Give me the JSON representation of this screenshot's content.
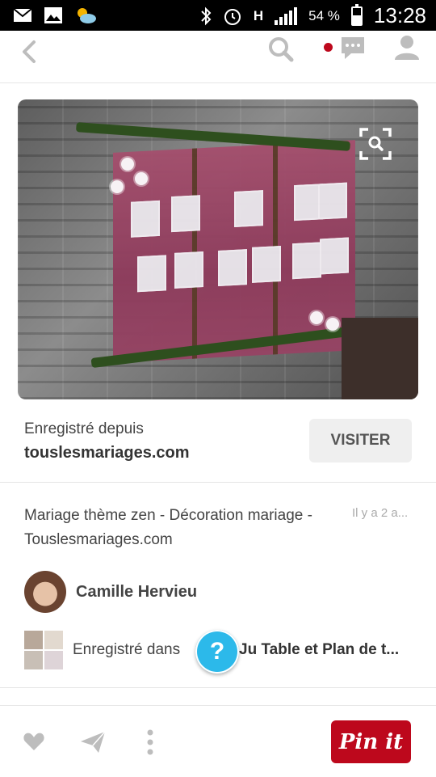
{
  "status_bar": {
    "battery_text": "54 %",
    "battery_level": 0.54,
    "time": "13:28",
    "network": "H"
  },
  "pin": {
    "saved_from_label": "Enregistré depuis",
    "source_domain": "touslesmariages.com",
    "visit_label": "VISITER",
    "description": "Mariage thème zen - Décoration mariage - Touslesmariages.com",
    "timestamp": "Il y a 2 a...",
    "author": "Camille Hervieu",
    "saved_in_label": "Enregistré dans",
    "board_name": "Ju Table et Plan de t...",
    "help_label": "?"
  },
  "actions": {
    "pin_it_label": "Pin it"
  },
  "colors": {
    "brand": "#bd081c",
    "help": "#2cb9ea"
  },
  "icons": [
    "back-icon",
    "search-icon",
    "messages-icon",
    "user-icon",
    "zoom-search-icon",
    "heart-icon",
    "send-icon",
    "more-icon"
  ]
}
